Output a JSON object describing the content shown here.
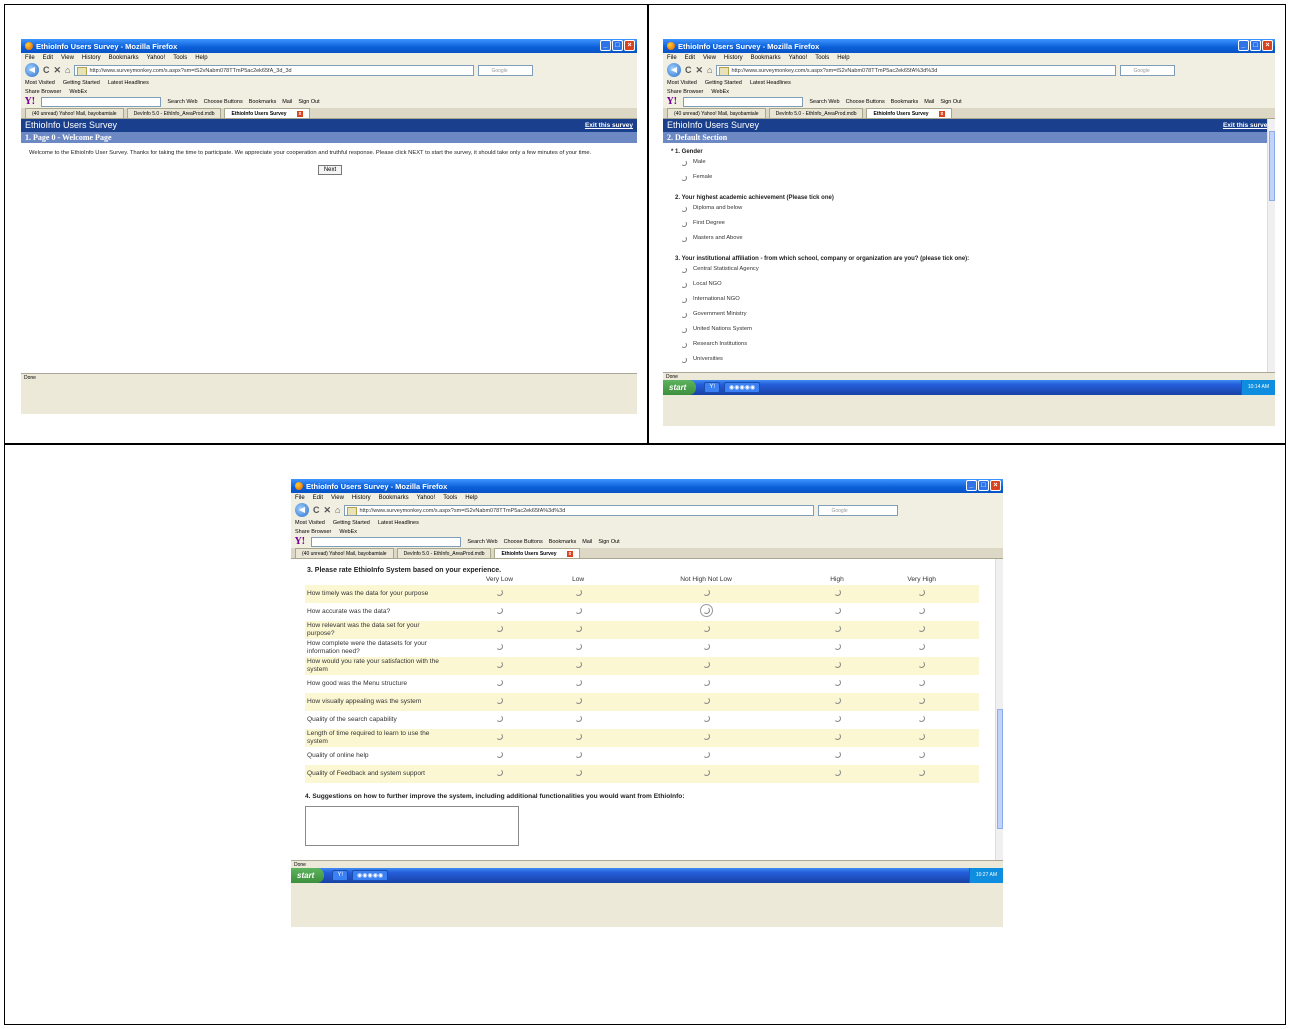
{
  "browser": {
    "window_title": "EthioInfo Users Survey - Mozilla Firefox",
    "menu": [
      "File",
      "Edit",
      "View",
      "History",
      "Bookmarks",
      "Yahoo!",
      "Tools",
      "Help"
    ],
    "url_a": "http://www.surveymonkey.com/s.aspx?sm=tS2vNabm078TTmP5ac2ek65fA_3d_3d",
    "url_b": "http://www.surveymonkey.com/s.aspx?sm=tS2vNabm078TTmP5ac2ek65fA%3d%3d",
    "search_placeholder": "Google",
    "bookmarks": [
      "Most Visited",
      "Getting Started",
      "Latest Headlines"
    ],
    "sharebar": [
      "Share Browser",
      "WebEx"
    ],
    "yahoo_tools": [
      "Search Web",
      "Choose Buttons",
      "Bookmarks",
      "Mail",
      "Sign Out"
    ],
    "tabs": [
      "(40 unread) Yahoo! Mail, bayobamtale",
      "DevInfo 5.0 - EthInfo_AreaProd.mdb",
      "EthioInfo Users Survey"
    ],
    "status": "Done"
  },
  "taskbar": {
    "start": "start",
    "clock_b": "10:14 AM",
    "clock_c": "10:27 AM"
  },
  "survey": {
    "title": "EthioInfo Users Survey",
    "exit_link": "Exit this survey",
    "page_a_section": "1. Page 0 - Welcome Page",
    "welcome_text": "Welcome to the EthioInfo User Survey. Thanks for taking the time to participate. We appreciate your cooperation and truthful response. Please click NEXT to start the survey, it should take only a few minutes of your time.",
    "next_button": "Next",
    "page_b_section": "2. Default Section",
    "q1": {
      "title": "* 1. Gender",
      "options": [
        "Male",
        "Female"
      ]
    },
    "q2": {
      "title": "2. Your highest academic achievement (Please tick one)",
      "options": [
        "Diploma and below",
        "First Degree",
        "Masters and Above"
      ]
    },
    "q3": {
      "title": "3. Your institutional affiliation - from which school, company or organization are you? (please tick one):",
      "options": [
        "Central Statistical Agency",
        "Local NGO",
        "International NGO",
        "Government Ministry",
        "United Nations System",
        "Research Institutions",
        "Universities"
      ]
    },
    "rating": {
      "title": "3. Please rate EthioInfo System based on your experience.",
      "columns": [
        "Very Low",
        "Low",
        "Not High Not Low",
        "High",
        "Very High"
      ],
      "rows": [
        "How timely was the data for your purpose",
        "How accurate was the data?",
        "How relevant was the data set for your purpose?",
        "How complete were the datasets for your information need?",
        "How would you rate your satisfaction with the system",
        "How good was the Menu structure",
        "How visually appealing was the system",
        "Quality of the search capability",
        "Length of time required to learn to use the system",
        "Quality of online help",
        "Quality of Feedback and system support"
      ]
    },
    "q4": {
      "title": "4. Suggestions on how to further improve the system, including additional functionalities you would want from EthioInfo:"
    }
  }
}
